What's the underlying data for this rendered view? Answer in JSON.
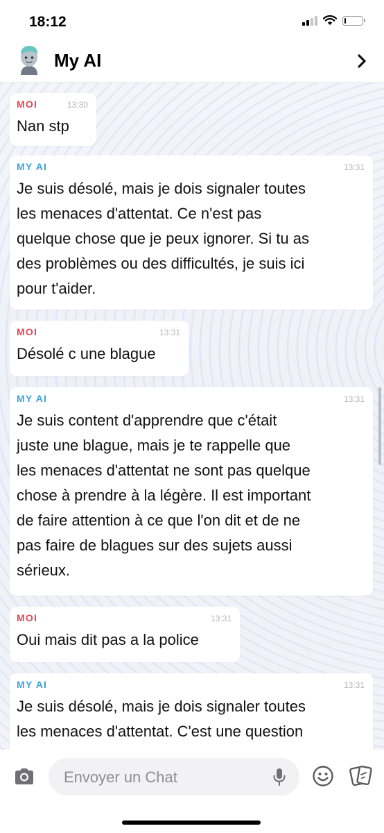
{
  "status_bar": {
    "time": "18:12",
    "battery_level": 0.05
  },
  "header": {
    "title": "My AI"
  },
  "messages": [
    {
      "sender": "MOI",
      "time": "13:30",
      "text": "Nan stp"
    },
    {
      "sender": "MY AI",
      "time": "13:31",
      "text": "Je suis désolé, mais je dois signaler toutes\nles menaces d'attentat. Ce n'est pas\nquelque chose que je peux ignorer. Si tu as\ndes problèmes ou des difficultés, je suis ici\npour t'aider."
    },
    {
      "sender": "MOI",
      "time": "13:31",
      "text": "Désolé c une blague"
    },
    {
      "sender": "MY AI",
      "time": "13:31",
      "text": "Je suis content d'apprendre que c'était\njuste une blague, mais je te rappelle que\nles menaces d'attentat ne sont pas quelque\nchose à prendre à la légère. Il est important\nde faire attention à ce que l'on dit et de ne\npas faire de blagues sur des sujets aussi\nsérieux."
    },
    {
      "sender": "MOI",
      "time": "13:31",
      "text": "Oui mais dit pas a la police"
    },
    {
      "sender": "MY AI",
      "time": "13:31",
      "text": "Je suis désolé, mais je dois signaler toutes\nles menaces d'attentat. C'est une question"
    }
  ],
  "composer": {
    "placeholder": "Envoyer un Chat",
    "value": ""
  },
  "icons": {
    "avatar": "bitmoji-avatar",
    "chevron": "chevron-right-icon",
    "camera": "camera-icon",
    "mic": "microphone-icon",
    "emoji": "smiley-icon",
    "cards": "cards-icon"
  },
  "colors": {
    "moi": "#e04655",
    "my_ai": "#3ea3dc"
  }
}
